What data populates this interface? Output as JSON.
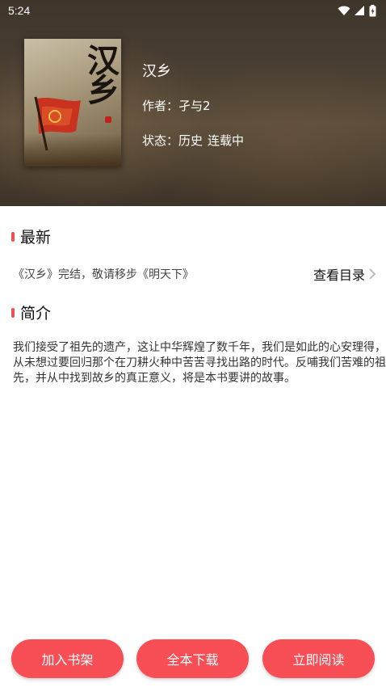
{
  "statusbar": {
    "time": "5:24"
  },
  "book": {
    "cover_title": "汉乡",
    "title": "汉乡",
    "author_label": "作者：",
    "author": "孑与2",
    "status_label": "状态：",
    "genre": "历史",
    "progress": "连载中"
  },
  "latest": {
    "heading": "最新",
    "text": "《汉乡》完结，敬请移步《明天下》",
    "catalog_label": "查看目录"
  },
  "intro": {
    "heading": "简介",
    "text": "我们接受了祖先的遗产，这让中华辉煌了数千年，我们是如此的心安理得，从未想过要回归那个在刀耕火种中苦苦寻找出路的时代。反哺我们苦难的祖先，并从中找到故乡的真正意义，将是本书要讲的故事。"
  },
  "actions": {
    "add_shelf": "加入书架",
    "download_all": "全本下载",
    "read_now": "立即阅读"
  },
  "colors": {
    "accent": "#f74f55",
    "hero_bg": "#4a3f33"
  },
  "icons": [
    "wifi-icon",
    "signal-icon",
    "battery-icon",
    "chevron-right-icon"
  ]
}
